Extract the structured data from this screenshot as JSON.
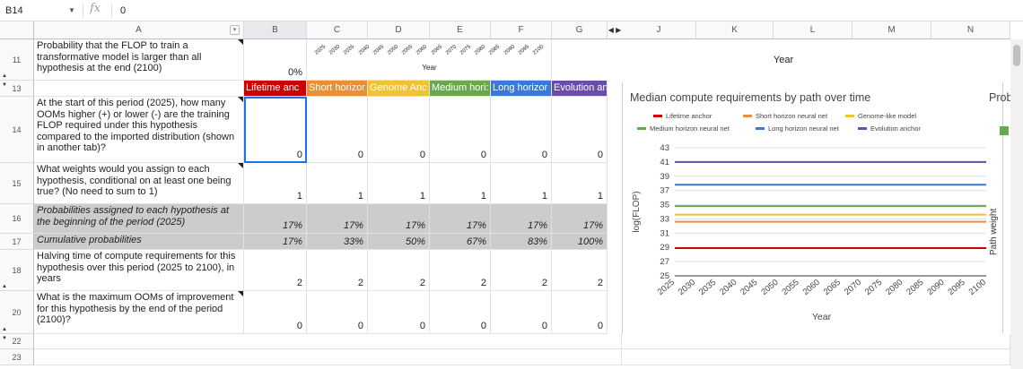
{
  "formula_bar": {
    "cell_ref": "B14",
    "fx": "fx",
    "value": "0"
  },
  "columns": [
    "A",
    "B",
    "C",
    "D",
    "E",
    "F",
    "G",
    "J",
    "K",
    "L",
    "M",
    "N"
  ],
  "rows": [
    "11",
    "13",
    "14",
    "15",
    "16",
    "17",
    "18",
    "20",
    "22",
    "23"
  ],
  "row11": {
    "a": "Probability that the FLOP to train a transformative model is larger than all hypothesis at the end (2100)",
    "b": "0%",
    "mini_years": [
      "2025",
      "2030",
      "2035",
      "2040",
      "2045",
      "2050",
      "2055",
      "2060",
      "2065",
      "2070",
      "2075",
      "2080",
      "2085",
      "2090",
      "2095",
      "2100"
    ],
    "mini_year_label": "Year",
    "year_label": "Year"
  },
  "hypotheses": [
    {
      "label": "Lifetime anchor",
      "short": "Lifetime anc",
      "color": "#cc0000"
    },
    {
      "label": "Short horizon neural net",
      "short": "Short horizor",
      "color": "#e69138"
    },
    {
      "label": "Genome-like model",
      "short": "Genome Anc",
      "color": "#f1c232"
    },
    {
      "label": "Medium horizon neural net",
      "short": "Medium hori:",
      "color": "#6aa84f"
    },
    {
      "label": "Long horizon neural net",
      "short": "Long horizor",
      "color": "#3c78d8"
    },
    {
      "label": "Evolution anchor",
      "short": "Evolution anc",
      "color": "#674ea7"
    }
  ],
  "row14": {
    "a": "At the start of this period (2025), how many OOMs higher (+) or lower (-) are the training FLOP required under this hypothesis compared to the imported distribution (shown in another tab)?",
    "values": [
      "0",
      "0",
      "0",
      "0",
      "0",
      "0"
    ]
  },
  "row15": {
    "a": "What weights would you assign to each hypothesis, conditional on at least one being true? (No need to sum to 1)",
    "values": [
      "1",
      "1",
      "1",
      "1",
      "1",
      "1"
    ]
  },
  "row16": {
    "a": "Probabilities assigned to each hypothesis at the beginning of the period (2025)",
    "values": [
      "17%",
      "17%",
      "17%",
      "17%",
      "17%",
      "17%"
    ]
  },
  "row17": {
    "a": "Cumulative probabilities",
    "values": [
      "17%",
      "33%",
      "50%",
      "67%",
      "83%",
      "100%"
    ]
  },
  "row18": {
    "a": "Halving time of compute requirements for this hypothesis over this period (2025 to 2100), in years",
    "values": [
      "2",
      "2",
      "2",
      "2",
      "2",
      "2"
    ]
  },
  "row20": {
    "a": "What is the maximum OOMs of improvement for this hypothesis by the end of the period (2100)?",
    "values": [
      "0",
      "0",
      "0",
      "0",
      "0",
      "0"
    ]
  },
  "side_chart": {
    "title": "Prob",
    "ylabel": "Path weight",
    "swatch_color": "#6aa84f"
  },
  "chart_data": {
    "type": "line",
    "title": "Median compute requirements by path over time",
    "xlabel": "Year",
    "ylabel": "log(FLOP)",
    "x": [
      2025,
      2030,
      2035,
      2040,
      2045,
      2050,
      2055,
      2060,
      2065,
      2070,
      2075,
      2080,
      2085,
      2090,
      2095,
      2100
    ],
    "ylim": [
      25,
      43
    ],
    "yticks": [
      25,
      27,
      29,
      31,
      33,
      35,
      37,
      39,
      41,
      43
    ],
    "grid": true,
    "legend": "top",
    "series": [
      {
        "name": "Lifetime anchor",
        "color": "#cc0000",
        "values": [
          28.9,
          28.9,
          28.9,
          28.9,
          28.9,
          28.9,
          28.9,
          28.9,
          28.9,
          28.9,
          28.9,
          28.9,
          28.9,
          28.9,
          28.9,
          28.9
        ]
      },
      {
        "name": "Short horizon neural net",
        "color": "#e69138",
        "values": [
          32.6,
          32.6,
          32.6,
          32.6,
          32.6,
          32.6,
          32.6,
          32.6,
          32.6,
          32.6,
          32.6,
          32.6,
          32.6,
          32.6,
          32.6,
          32.6
        ]
      },
      {
        "name": "Genome-like model",
        "color": "#f1c232",
        "values": [
          33.6,
          33.6,
          33.6,
          33.6,
          33.6,
          33.6,
          33.6,
          33.6,
          33.6,
          33.6,
          33.6,
          33.6,
          33.6,
          33.6,
          33.6,
          33.6
        ]
      },
      {
        "name": "Medium horizon neural net",
        "color": "#6aa84f",
        "values": [
          34.8,
          34.8,
          34.8,
          34.8,
          34.8,
          34.8,
          34.8,
          34.8,
          34.8,
          34.8,
          34.8,
          34.8,
          34.8,
          34.8,
          34.8,
          34.8
        ]
      },
      {
        "name": "Long horizon neural net",
        "color": "#3c78d8",
        "values": [
          37.8,
          37.8,
          37.8,
          37.8,
          37.8,
          37.8,
          37.8,
          37.8,
          37.8,
          37.8,
          37.8,
          37.8,
          37.8,
          37.8,
          37.8,
          37.8
        ]
      },
      {
        "name": "Evolution anchor",
        "color": "#674ea7",
        "values": [
          41.0,
          41.0,
          41.0,
          41.0,
          41.0,
          41.0,
          41.0,
          41.0,
          41.0,
          41.0,
          41.0,
          41.0,
          41.0,
          41.0,
          41.0,
          41.0
        ]
      }
    ]
  }
}
